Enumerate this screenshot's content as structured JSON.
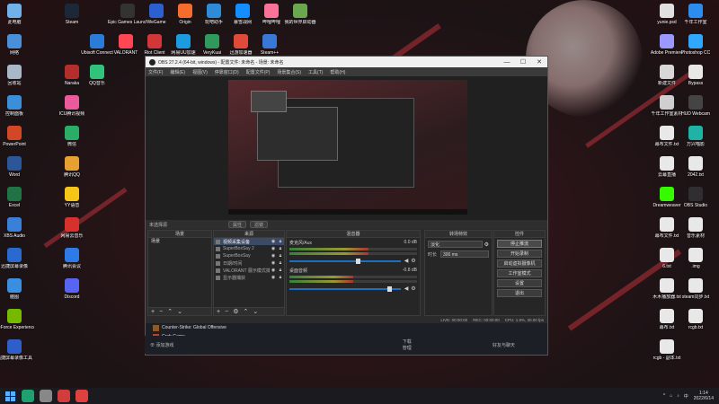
{
  "desktop": {
    "icons_left": [
      {
        "label": "此电脑",
        "color": "#6fb1e8"
      },
      {
        "label": "网络",
        "color": "#4a90d9"
      },
      {
        "label": "回收站",
        "color": "#a8b8c8"
      },
      {
        "label": "控制面板",
        "color": "#3a8fd8"
      },
      {
        "label": "PowerPoint",
        "color": "#d24726"
      },
      {
        "label": "Word",
        "color": "#2b579a"
      },
      {
        "label": "Excel",
        "color": "#217346"
      },
      {
        "label": "XBS Audio",
        "color": "#3a7fd8"
      },
      {
        "label": "迅捷屏幕录像",
        "color": "#2a6ad0"
      },
      {
        "label": "脑图",
        "color": "#3c8ee0"
      },
      {
        "label": "GeForce Experience",
        "color": "#76b900"
      },
      {
        "label": "迅捷屏幕录像工具",
        "color": "#2e5fc8"
      }
    ],
    "icons_col2": [
      {
        "label": "Steam",
        "color": "#1b2838"
      },
      {
        "label": "Naraka",
        "color": "#b42e2e"
      },
      {
        "label": "ICU腾讯视频",
        "color": "#ea5b9c"
      },
      {
        "label": "微信",
        "color": "#2aae67"
      },
      {
        "label": "腾讯QQ",
        "color": "#e8a030"
      },
      {
        "label": "YY语音",
        "color": "#f5c518"
      },
      {
        "label": "网易云音乐",
        "color": "#d6322b"
      },
      {
        "label": "腾讯会议",
        "color": "#2e7be8"
      },
      {
        "label": "Discord",
        "color": "#5865f2"
      }
    ],
    "icons_top": [
      {
        "label": "Epic Games Launcher",
        "color": "#333"
      },
      {
        "label": "WeGame",
        "color": "#2c5fd0"
      },
      {
        "label": "Origin",
        "color": "#f56c2d"
      },
      {
        "label": "玩吧助手",
        "color": "#2e8bd8"
      },
      {
        "label": "暴雪战网",
        "color": "#148eff"
      },
      {
        "label": "哔哩哔哩",
        "color": "#fb7299"
      },
      {
        "label": "我的世界启动器",
        "color": "#6aa84f"
      },
      {
        "label": "Ubisoft Connect",
        "color": "#2b7bd8"
      },
      {
        "label": "VALORANT",
        "color": "#ff4655"
      },
      {
        "label": "Riot Client",
        "color": "#d13639"
      },
      {
        "label": "网易UU加速",
        "color": "#1c9be0"
      },
      {
        "label": "VeryKuai",
        "color": "#2f9a5c"
      },
      {
        "label": "迅游加速器",
        "color": "#e04a3a"
      },
      {
        "label": "Steam++",
        "color": "#3a78d8"
      },
      {
        "label": "QQ音乐",
        "color": "#31c27c"
      }
    ],
    "icons_right": [
      {
        "label": "yunie.psd",
        "color": "#e0e0e0"
      },
      {
        "label": "千年工作室",
        "color": "#2d8cf0"
      },
      {
        "label": "Adobe Premiere",
        "color": "#9999ff"
      },
      {
        "label": "Photoshop CC",
        "color": "#31a8ff"
      },
      {
        "label": "新建文件",
        "color": "#d8d8d8"
      },
      {
        "label": "Bypass",
        "color": "#e8e8e8"
      },
      {
        "label": "千年工作室素材",
        "color": "#cfcfcf"
      },
      {
        "label": "HUD Webcam",
        "color": "#444"
      },
      {
        "label": "幕布文件.txt",
        "color": "#e8e8e8"
      },
      {
        "label": "万兴喵影",
        "color": "#1fb3a5"
      },
      {
        "label": "云幕直播",
        "color": "#e8e8e8"
      },
      {
        "label": "2042.txt",
        "color": "#e8e8e8"
      },
      {
        "label": "Dreamweaver",
        "color": "#35fa00"
      },
      {
        "label": "OBS Studio",
        "color": "#302e31"
      },
      {
        "label": "幕布文件.txt",
        "color": "#e8e8e8"
      },
      {
        "label": "音乐素材",
        "color": "#e8e8e8"
      },
      {
        "label": "6.txt",
        "color": "#e8e8e8"
      },
      {
        "label": ".img",
        "color": "#e8e8e8"
      },
      {
        "label": "木木播放器.txt",
        "color": "#e8e8e8"
      },
      {
        "label": "steam同步.txt",
        "color": "#e8e8e8"
      },
      {
        "label": "幕布.txt",
        "color": "#e8e8e8"
      },
      {
        "label": "rcgb.txt",
        "color": "#e8e8e8"
      },
      {
        "label": "rcgb - 副本.txt",
        "color": "#e8e8e8"
      }
    ]
  },
  "obs": {
    "title": "OBS 27.2.4 (64-bit, windows) - 配置文件: 未命名 - 场景: 未命名",
    "window_controls": [
      "—",
      "☐",
      "✕"
    ],
    "menu": [
      "文件(F)",
      "编辑(E)",
      "视图(V)",
      "停靠窗口(D)",
      "配置文件(P)",
      "场景集合(S)",
      "工具(T)",
      "帮助(H)"
    ],
    "preview_bar": {
      "no_source": "未选择源",
      "props": "属性",
      "filters": "滤镜"
    },
    "scenes": {
      "header": "场景",
      "items": [
        "场景"
      ]
    },
    "sources": {
      "header": "来源",
      "items": [
        {
          "name": "视频采集设备",
          "visible": true
        },
        {
          "name": "SuperBoxSay 2",
          "visible": true
        },
        {
          "name": "SuperBoxSay",
          "visible": true
        },
        {
          "name": "日期/时间",
          "visible": true
        },
        {
          "name": "VALORANT 展示模式捕获",
          "visible": true
        },
        {
          "name": "显示器捕获",
          "visible": true
        }
      ]
    },
    "mixer": {
      "header": "混音器",
      "channels": [
        {
          "name": "麦克风/Aux",
          "db": "0.0 dB",
          "level": 0.62,
          "volume": 0.6
        },
        {
          "name": "桌面音频",
          "db": "-0.8 dB",
          "level": 0.5,
          "volume": 0.88
        }
      ]
    },
    "transitions": {
      "header": "转场特效",
      "type": "淡化",
      "duration_label": "时长",
      "duration": "300 ms"
    },
    "controls": {
      "header": "控件",
      "buttons": [
        "停止推流",
        "开始录制",
        "启动虚拟摄像机",
        "工作室模式",
        "设置",
        "退出"
      ]
    },
    "status": {
      "live": "LIVE: 00:00:00",
      "rec": "REC: 00:00:00",
      "cpu": "CPU: 1.9%, 30.00 fps"
    }
  },
  "steam": {
    "items": [
      "Counter-Strike: Global Offensive",
      "Crab Game"
    ],
    "add_game": "添加游戏",
    "downloads": "下载",
    "downloads_sub": "管理",
    "friends": "好友与聊天"
  },
  "taskbar": {
    "apps": [
      {
        "name": "app-1",
        "color": "#20a070"
      },
      {
        "name": "app-2",
        "color": "#888"
      },
      {
        "name": "app-3",
        "color": "#d23c3c"
      },
      {
        "name": "app-4",
        "color": "#e04040"
      }
    ],
    "time": "1:14",
    "date": "2022/6/14"
  }
}
